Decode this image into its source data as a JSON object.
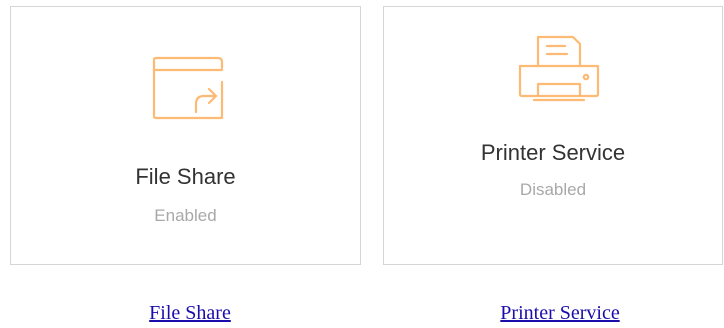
{
  "colors": {
    "accent": "#FDBA74",
    "border": "#D5D5D5",
    "title": "#333333",
    "status": "#A8A8A8",
    "link": "#1A0DAB"
  },
  "cards": [
    {
      "icon": "file-share-icon",
      "title": "File Share",
      "status": "Enabled"
    },
    {
      "icon": "printer-icon",
      "title": "Printer Service",
      "status": "Disabled"
    }
  ],
  "links": [
    {
      "label": "File Share"
    },
    {
      "label": "Printer Service"
    }
  ]
}
